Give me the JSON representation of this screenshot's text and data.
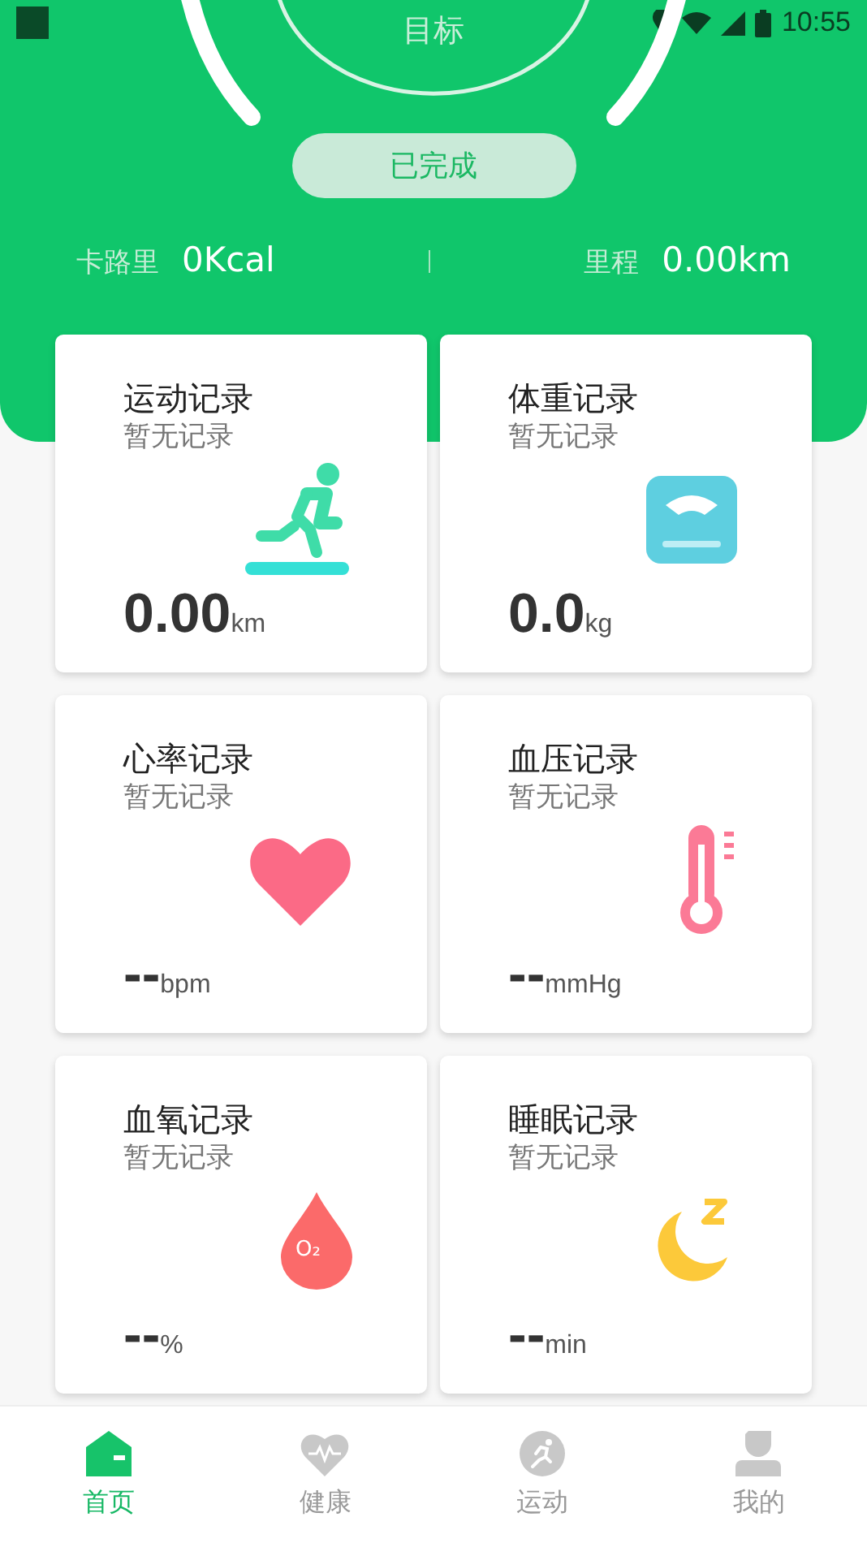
{
  "status_bar": {
    "time": "10:55"
  },
  "goal": {
    "label": "目标",
    "button": "已完成"
  },
  "stats": [
    {
      "label": "卡路里",
      "value": "0Kcal"
    },
    {
      "label": "里程",
      "value": "0.00km"
    }
  ],
  "cards": [
    {
      "kind": "run",
      "title": "运动记录",
      "subtitle": "暂无记录",
      "value": "0.00",
      "unit": "km"
    },
    {
      "kind": "scale",
      "title": "体重记录",
      "subtitle": "暂无记录",
      "value": "0.0",
      "unit": "kg"
    },
    {
      "kind": "heart",
      "title": "心率记录",
      "subtitle": "暂无记录",
      "value": "--",
      "unit": "bpm"
    },
    {
      "kind": "thermometer",
      "title": "血压记录",
      "subtitle": "暂无记录",
      "value": "--",
      "unit": "mmHg"
    },
    {
      "kind": "drop",
      "title": "血氧记录",
      "subtitle": "暂无记录",
      "value": "--",
      "unit": "%",
      "badge": "O₂"
    },
    {
      "kind": "moon",
      "title": "睡眠记录",
      "subtitle": "暂无记录",
      "value": "--",
      "unit": "min"
    }
  ],
  "tabs": [
    {
      "kind": "home",
      "label": "首页",
      "selected": true
    },
    {
      "kind": "health",
      "label": "健康",
      "selected": false
    },
    {
      "kind": "sport",
      "label": "运动",
      "selected": false
    },
    {
      "kind": "me",
      "label": "我的",
      "selected": false
    }
  ]
}
